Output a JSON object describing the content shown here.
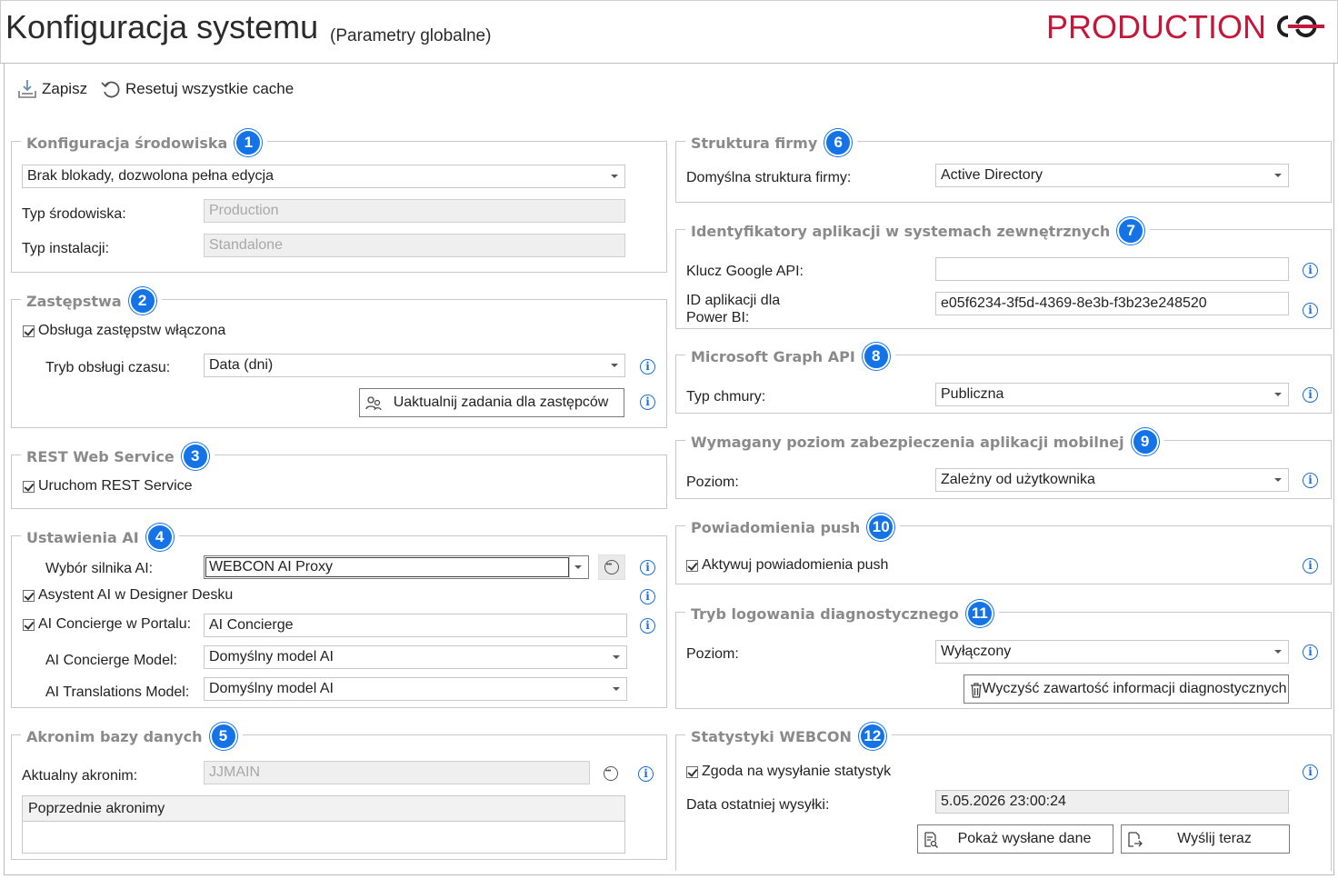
{
  "header": {
    "title": "Konfiguracja systemu",
    "subtitle": "(Parametry globalne)",
    "environment": "PRODUCTION",
    "environment_color": "#c5173a",
    "logo": "webcon-logo-icon"
  },
  "toolbar": {
    "save_label": "Zapisz",
    "save_icon": "save-icon",
    "reset_label": "Resetuj wszystkie cache",
    "reset_icon": "reset-icon"
  },
  "badge_color": "#1473e6",
  "sections": {
    "env": {
      "title": "Konfiguracja środowiska",
      "badge": "1",
      "lock_mode": "Brak blokady, dozwolona pełna edycja",
      "type_label": "Typ środowiska:",
      "type_value": "Production",
      "install_label": "Typ instalacji:",
      "install_value": "Standalone"
    },
    "subst": {
      "title": "Zastępstwa",
      "badge": "2",
      "enabled_label": "Obsługa zastępstw włączona",
      "time_label": "Tryb obsługi czasu:",
      "time_value": "Data (dni)",
      "update_button": "Uaktualnij zadania dla zastępców"
    },
    "rest": {
      "title": "REST Web Service",
      "badge": "3",
      "run_label": "Uruchom REST Service"
    },
    "ai": {
      "title": "Ustawienia AI",
      "badge": "4",
      "engine_label": "Wybór silnika AI:",
      "engine_value": "WEBCON AI Proxy",
      "designer_label": "Asystent AI w Designer Desku",
      "concierge_label": "AI Concierge w Portalu:",
      "concierge_value": "AI Concierge",
      "concierge_model_label": "AI Concierge Model:",
      "concierge_model_value": "Domyślny model AI",
      "translations_label": "AI Translations Model:",
      "translations_value": "Domyślny model AI"
    },
    "acronym": {
      "title": "Akronim bazy danych",
      "badge": "5",
      "current_label": "Aktualny akronim:",
      "current_value": "JJMAIN",
      "previous_header": "Poprzednie akronimy"
    },
    "company": {
      "title": "Struktura firmy",
      "badge": "6",
      "default_label": "Domyślna struktura firmy:",
      "default_value": "Active Directory"
    },
    "ids": {
      "title": "Identyfikatory aplikacji w systemach zewnętrznych",
      "badge": "7",
      "google_label": "Klucz Google API:",
      "google_value": "",
      "powerbi_label_1": "ID aplikacji dla",
      "powerbi_label_2": "Power BI:",
      "powerbi_value": "e05f6234-3f5d-4369-8e3b-f3b23e248520"
    },
    "graph": {
      "title": "Microsoft Graph API",
      "badge": "8",
      "cloud_label": "Typ chmury:",
      "cloud_value": "Publiczna"
    },
    "mobile": {
      "title": "Wymagany poziom zabezpieczenia aplikacji mobilnej",
      "badge": "9",
      "level_label": "Poziom:",
      "level_value": "Zależny od użytkownika"
    },
    "push": {
      "title": "Powiadomienia push",
      "badge": "10",
      "activate_label": "Aktywuj powiadomienia push"
    },
    "diag": {
      "title": "Tryb logowania diagnostycznego",
      "badge": "11",
      "level_label": "Poziom:",
      "level_value": "Wyłączony",
      "clear_button": "Wyczyść zawartość informacji diagnostycznych"
    },
    "stats": {
      "title": "Statystyki WEBCON",
      "badge": "12",
      "consent_label": "Zgoda na wysyłanie statystyk",
      "last_label": "Data ostatniej wysyłki:",
      "last_value": "5.05.2026 23:00:24",
      "show_button": "Pokaż wysłane dane",
      "send_button": "Wyślij teraz"
    }
  }
}
